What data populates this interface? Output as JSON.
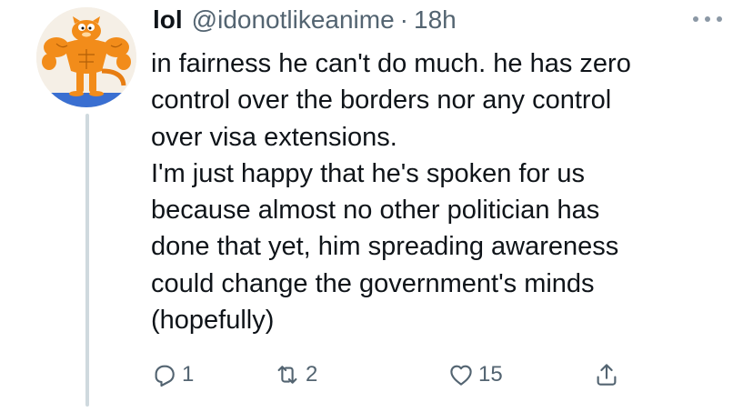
{
  "tweet": {
    "display_name": "lol",
    "handle": "@idonotlikeanime",
    "separator": "·",
    "time": "18h",
    "text_lines": [
      "in fairness he can't do much. he has zero",
      "control over the borders nor any control",
      "over visa extensions.",
      "I'm just happy that he's spoken for us",
      "because almost no other politician has",
      "done that yet, him spreading awareness",
      "could change the government's minds",
      "(hopefully)"
    ],
    "reply_count": "1",
    "retweet_count": "2",
    "like_count": "15"
  },
  "icons": {
    "avatar": "muscular-cartoon-cat-avatar",
    "more": "more-options-icon",
    "reply": "reply-icon",
    "retweet": "retweet-icon",
    "like": "heart-icon",
    "share": "share-icon"
  },
  "colors": {
    "text": "#0f1419",
    "secondary_text": "#536471",
    "thread_line": "#cfd9de",
    "avatar_orange": "#f28c1a"
  }
}
